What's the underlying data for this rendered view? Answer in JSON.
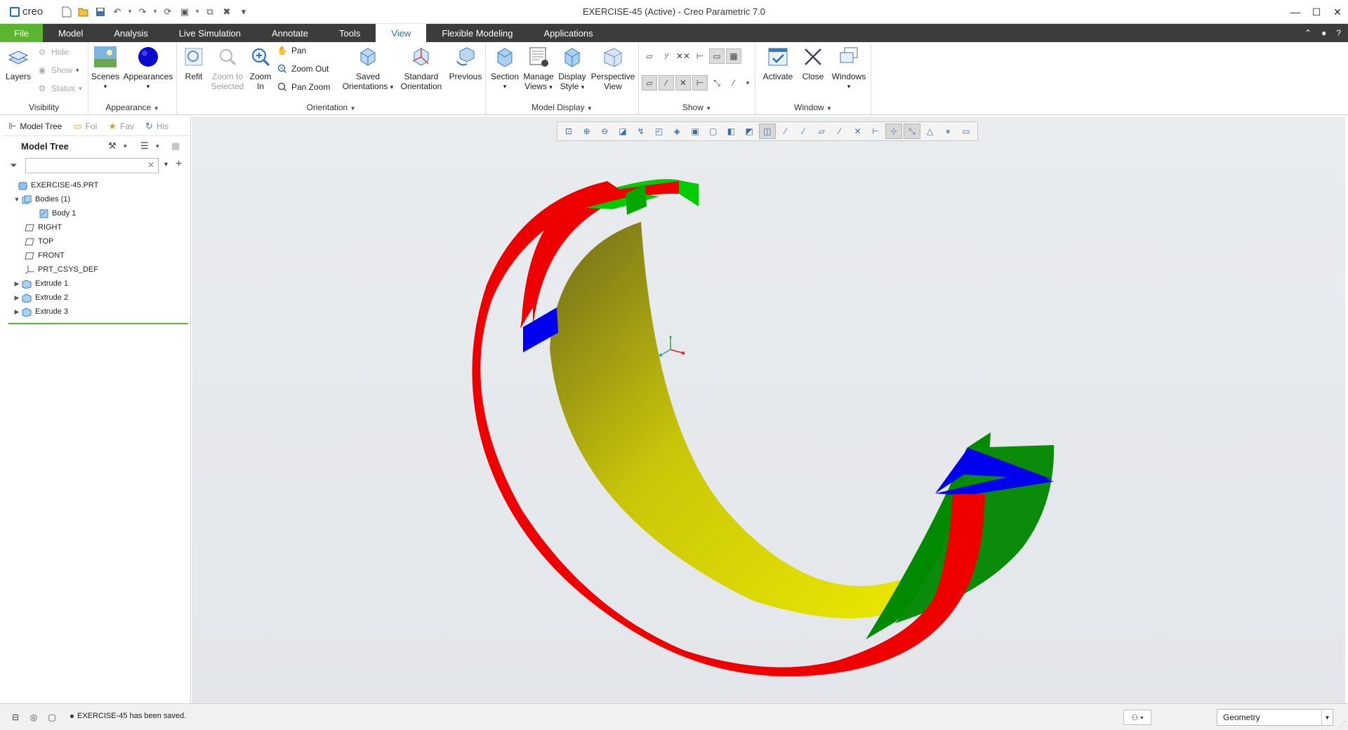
{
  "app": {
    "logo_text": "creo",
    "window_title": "EXERCISE-45 (Active) - Creo Parametric 7.0"
  },
  "quick_access": [
    "new-icon",
    "open-icon",
    "save-icon",
    "undo-icon",
    "redo-icon",
    "regenerate-icon",
    "windows-icon",
    "close-window-icon",
    "customize-icon"
  ],
  "window_controls": {
    "minimize": "—",
    "maximize": "☐",
    "close": "✕"
  },
  "tabs": [
    {
      "label": "File",
      "state": "file"
    },
    {
      "label": "Model",
      "state": ""
    },
    {
      "label": "Analysis",
      "state": ""
    },
    {
      "label": "Live Simulation",
      "state": ""
    },
    {
      "label": "Annotate",
      "state": ""
    },
    {
      "label": "Tools",
      "state": ""
    },
    {
      "label": "View",
      "state": "active"
    },
    {
      "label": "Flexible Modeling",
      "state": ""
    },
    {
      "label": "Applications",
      "state": ""
    }
  ],
  "ribbon": {
    "visibility": {
      "label": "Visibility",
      "layers": "Layers",
      "hide": "Hide",
      "show": "Show",
      "status": "Status"
    },
    "appearance": {
      "label": "Appearance",
      "scenes": "Scenes",
      "appearances": "Appearances"
    },
    "orientation": {
      "label": "Orientation",
      "refit": "Refit",
      "zoom_to_selected_1": "Zoom to",
      "zoom_to_selected_2": "Selected",
      "zoom_in_1": "Zoom",
      "zoom_in_2": "In",
      "pan": "Pan",
      "zoom_out": "Zoom Out",
      "pan_zoom": "Pan Zoom",
      "saved_1": "Saved",
      "saved_2": "Orientations",
      "standard_1": "Standard",
      "standard_2": "Orientation",
      "previous": "Previous"
    },
    "model_display": {
      "label": "Model Display",
      "section": "Section",
      "manage_1": "Manage",
      "manage_2": "Views",
      "display_1": "Display",
      "display_2": "Style",
      "perspective_1": "Perspective",
      "perspective_2": "View"
    },
    "show": {
      "label": "Show"
    },
    "window": {
      "label": "Window",
      "activate": "Activate",
      "close": "Close",
      "windows": "Windows"
    }
  },
  "navigator": {
    "tabs": [
      {
        "label": "Model Tree",
        "icon": "model-tree-icon"
      },
      {
        "label": "Fol",
        "icon": "folder-icon"
      },
      {
        "label": "Fav",
        "icon": "favorites-icon"
      },
      {
        "label": "His",
        "icon": "history-icon"
      }
    ],
    "tree_title": "Model Tree",
    "search_placeholder": "",
    "items": [
      {
        "label": "EXERCISE-45.PRT",
        "icon": "part-icon",
        "indent": 0,
        "expander": ""
      },
      {
        "label": "Bodies (1)",
        "icon": "bodies-icon",
        "indent": 1,
        "expander": "▼"
      },
      {
        "label": "Body 1",
        "icon": "body-icon",
        "indent": 2,
        "expander": ""
      },
      {
        "label": "RIGHT",
        "icon": "datum-plane-icon",
        "indent": 1,
        "expander": ""
      },
      {
        "label": "TOP",
        "icon": "datum-plane-icon",
        "indent": 1,
        "expander": ""
      },
      {
        "label": "FRONT",
        "icon": "datum-plane-icon",
        "indent": 1,
        "expander": ""
      },
      {
        "label": "PRT_CSYS_DEF",
        "icon": "csys-icon",
        "indent": 1,
        "expander": ""
      },
      {
        "label": "Extrude 1",
        "icon": "extrude-icon",
        "indent": 1,
        "expander": "▶"
      },
      {
        "label": "Extrude 2",
        "icon": "extrude-icon",
        "indent": 1,
        "expander": "▶"
      },
      {
        "label": "Extrude 3",
        "icon": "extrude-icon",
        "indent": 1,
        "expander": "▶"
      }
    ]
  },
  "colors": {
    "file_tab": "#5cb531",
    "tab_bar": "#3c3c3c",
    "active_tab_text": "#2a6fb4",
    "model_red": "#ee0000",
    "model_green": "#00cc00",
    "model_blue": "#0000ee",
    "model_yellow": "#e6e600"
  },
  "status": {
    "message": "EXERCISE-45 has been saved.",
    "filter_value": "Geometry"
  }
}
